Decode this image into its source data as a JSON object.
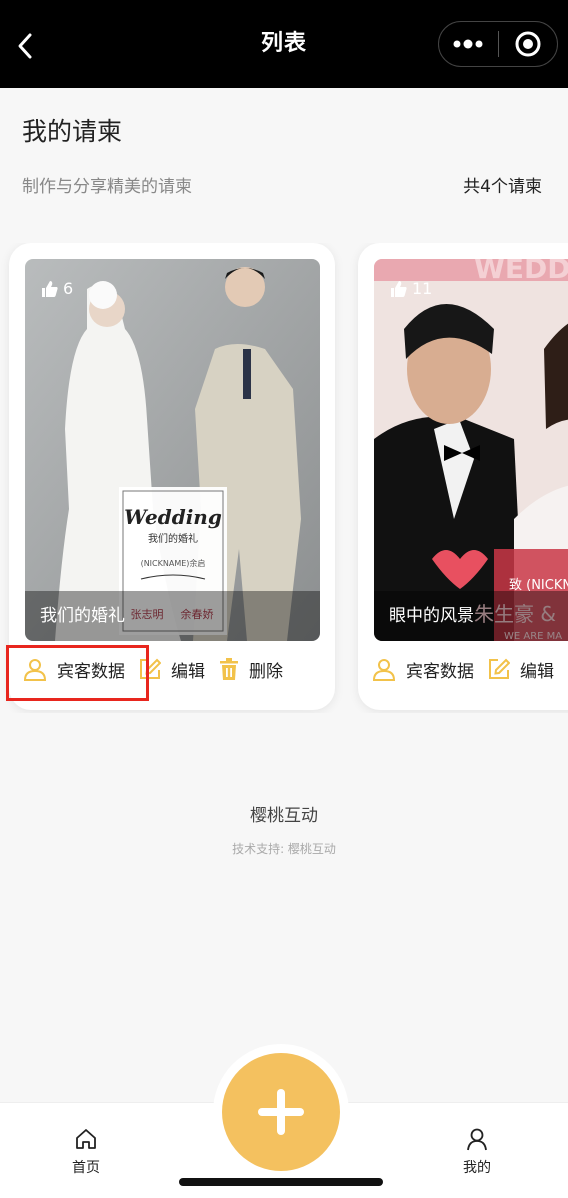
{
  "nav": {
    "title": "列表"
  },
  "header": {
    "title": "我的请柬",
    "subtitle": "制作与分享精美的请柬",
    "count_text": "共4个请柬"
  },
  "cards": [
    {
      "likes": "6",
      "caption": "我们的婚礼",
      "overlay": {
        "heading": "Wedding",
        "subheading": "我们的婚礼",
        "nickname": "(NICKNAME)余启",
        "groom": "张志明",
        "bride": "余春娇"
      },
      "actions": {
        "guest": "宾客数据",
        "edit": "编辑",
        "delete": "删除"
      }
    },
    {
      "likes": "11",
      "caption": "眼中的风景",
      "overlay": {
        "banner": "WEDDI",
        "invite": "致 (NICKN",
        "names": "朱生豪 &",
        "tagline": "WE ARE MA"
      },
      "actions": {
        "guest": "宾客数据",
        "edit": "编辑"
      }
    }
  ],
  "footer": {
    "brand": "樱桃互动",
    "support": "技术支持: 樱桃互动"
  },
  "tabbar": {
    "home": "首页",
    "mine": "我的"
  },
  "colors": {
    "accent": "#f4c15f",
    "icon": "#f2c24a",
    "highlight": "#e8261e"
  }
}
